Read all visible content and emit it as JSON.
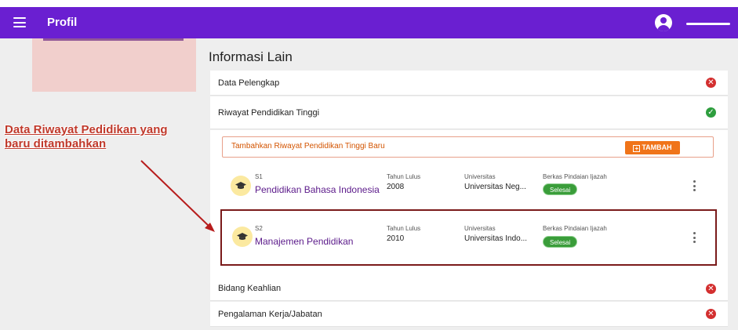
{
  "app": {
    "title": "Profil"
  },
  "section_heading": "Informasi Lain",
  "annotation": {
    "line1": "Data Riwayat Pedidikan yang",
    "line2": "baru ditambahkan"
  },
  "rows": {
    "data_pelengkap": {
      "label": "Data Pelengkap",
      "status": "error"
    },
    "riwayat_pendidikan": {
      "label": "Riwayat Pendidikan Tinggi",
      "status": "complete"
    },
    "bidang_keahlian": {
      "label": "Bidang Keahlian",
      "status": "error"
    },
    "pengalaman_kerja": {
      "label": "Pengalaman Kerja/Jabatan",
      "status": "error"
    }
  },
  "add_panel": {
    "label": "Tambahkan Riwayat Pendidikan Tinggi Baru",
    "button_label": "TAMBAH"
  },
  "education": [
    {
      "level": "S1",
      "degree": "Pendidikan Bahasa Indonesia",
      "year_label": "Tahun Lulus",
      "year": "2008",
      "university_label": "Universitas",
      "university": "Universitas Neg...",
      "file_label": "Berkas Pindaian Ijazah",
      "file_status": "Selesai"
    },
    {
      "level": "S2",
      "degree": "Manajemen Pendidikan",
      "year_label": "Tahun Lulus",
      "year": "2010",
      "university_label": "Universitas",
      "university": "Universitas Indo...",
      "file_label": "Berkas Pindaian Ijazah",
      "file_status": "Selesai"
    }
  ],
  "icons": {
    "menu": "menu-icon",
    "avatar": "account-circle-icon",
    "error": "close-circle-icon",
    "ok": "check-circle-icon",
    "education": "graduation-cap-icon",
    "more": "more-vert-icon",
    "add": "add-box-icon"
  },
  "colors": {
    "appbar": "#6a1fd1",
    "accent_orange": "#f07419",
    "success": "#2e9e3e",
    "error": "#d32f2f",
    "annotation": "#c0392b"
  }
}
